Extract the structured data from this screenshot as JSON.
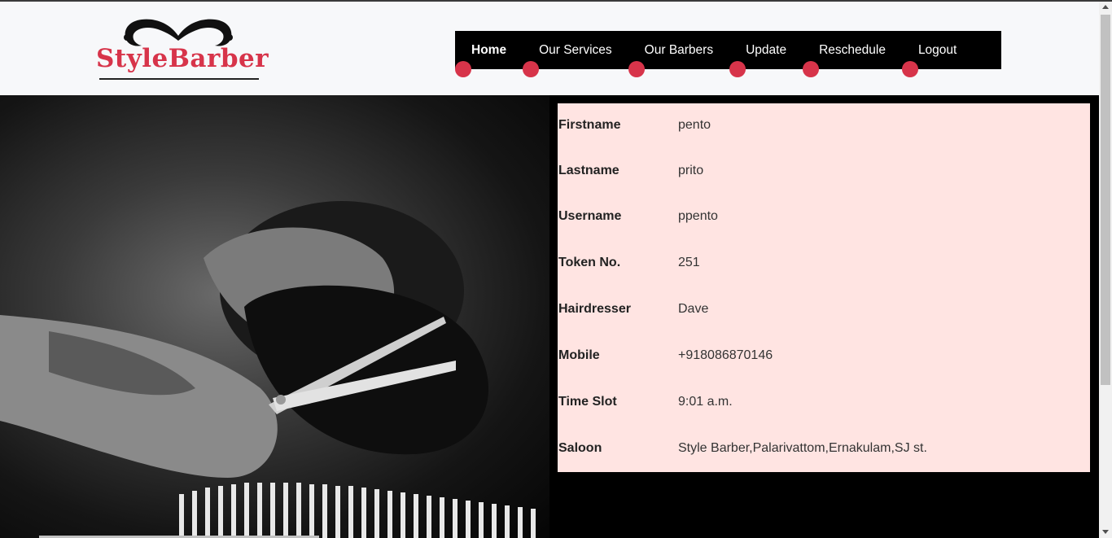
{
  "brand": {
    "name": "StyleBarber",
    "accent": "#d7344a"
  },
  "nav": {
    "items": [
      {
        "label": "Home",
        "active": true
      },
      {
        "label": "Our Services",
        "active": false
      },
      {
        "label": "Our Barbers",
        "active": false
      },
      {
        "label": "Update",
        "active": false
      },
      {
        "label": "Reschedule",
        "active": false
      },
      {
        "label": "Logout",
        "active": false
      }
    ]
  },
  "photo": {
    "subject": "barber-photo"
  },
  "details": {
    "background": "#ffe4e2",
    "rows": [
      {
        "label": "Firstname",
        "value": "pento"
      },
      {
        "label": "Lastname",
        "value": "prito"
      },
      {
        "label": "Username",
        "value": "ppento"
      },
      {
        "label": "Token No.",
        "value": "251"
      },
      {
        "label": "Hairdresser",
        "value": "Dave"
      },
      {
        "label": "Mobile",
        "value": "+918086870146"
      },
      {
        "label": "Time Slot",
        "value": "9:01 a.m."
      },
      {
        "label": "Saloon",
        "value": "Style Barber,Palarivattom,Ernakulam,SJ st."
      }
    ]
  }
}
